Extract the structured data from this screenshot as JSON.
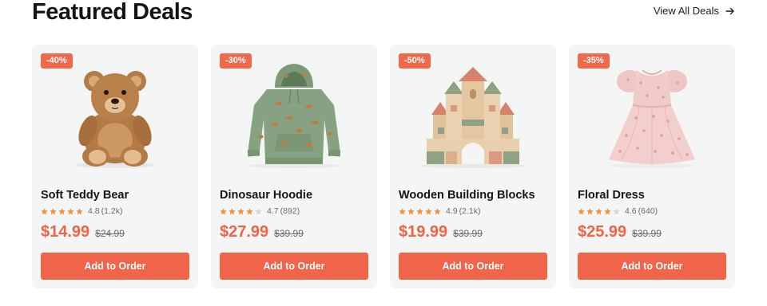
{
  "header": {
    "title": "Featured Deals",
    "view_all_label": "View All Deals",
    "view_all_icon": "arrow-right-icon"
  },
  "colors": {
    "accent": "#f0654a",
    "star": "#f2913a",
    "star_empty": "#d6d6d6",
    "card_bg": "#f4f5f5"
  },
  "products": [
    {
      "name": "Soft Teddy Bear",
      "discount": "-40%",
      "rating": 4.8,
      "rating_text": "4.8",
      "reviews": "(1.2k)",
      "price": "$14.99",
      "old_price": "$24.99",
      "button": "Add to Order",
      "image": "teddy-bear"
    },
    {
      "name": "Dinosaur Hoodie",
      "discount": "-30%",
      "rating": 4.7,
      "rating_text": "4.7",
      "reviews": "(892)",
      "price": "$27.99",
      "old_price": "$39.99",
      "button": "Add to Order",
      "image": "dinosaur-hoodie"
    },
    {
      "name": "Wooden Building Blocks",
      "discount": "-50%",
      "rating": 4.9,
      "rating_text": "4.9",
      "reviews": "(2.1k)",
      "price": "$19.99",
      "old_price": "$39.99",
      "button": "Add to Order",
      "image": "wooden-blocks"
    },
    {
      "name": "Floral Dress",
      "discount": "-35%",
      "rating": 4.6,
      "rating_text": "4.6",
      "reviews": "(640)",
      "price": "$25.99",
      "old_price": "$39.99",
      "button": "Add to Order",
      "image": "floral-dress"
    }
  ]
}
